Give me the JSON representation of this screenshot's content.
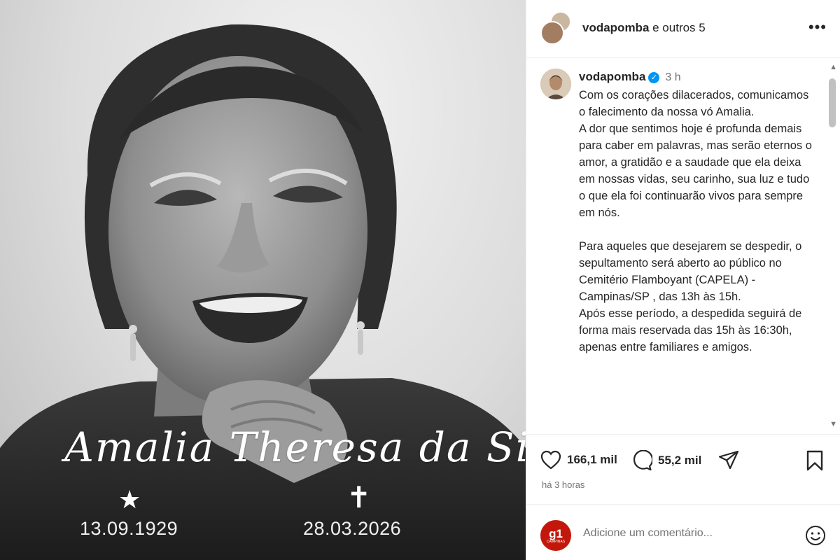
{
  "photo": {
    "name_signature": "Amalia Theresa da Silva",
    "birth_date": "13.09.1929",
    "death_date": "28.03.2026",
    "birth_symbol": "★",
    "death_symbol": "✝"
  },
  "header": {
    "username": "vodapomba",
    "others": " e outros 5",
    "more_icon": "more-horizontal-icon",
    "more_label": "•••"
  },
  "caption": {
    "username": "vodapomba",
    "verified_mark": "✓",
    "time": "3 h",
    "text": "Com os corações dilacerados, comunicamos o falecimento da nossa vó Amalia.\nA dor que sentimos hoje é profunda demais para caber em palavras, mas serão eternos o amor, a gratidão e a saudade que ela deixa em nossas vidas, seu carinho, sua luz e tudo o que ela foi continuarão vivos para sempre em nós.\n\nPara aqueles que desejarem se despedir, o sepultamento será aberto ao público no Cemitério Flamboyant (CAPELA) - Campinas/SP , das 13h às 15h.\nApós esse período, a despedida seguirá de forma mais reservada das 15h às 16:30h, apenas entre familiares e amigos."
  },
  "scrollbar": {
    "up": "▲",
    "down": "▼"
  },
  "actions": {
    "likes": "166,1 mil",
    "comments": "55,2 mil",
    "time_ago": "há 3 horas"
  },
  "comment_bar": {
    "avatar_label": "g1",
    "avatar_sub": "CAMPINAS",
    "placeholder": "Adicione um comentário..."
  },
  "colors": {
    "verified": "#0095f6",
    "g1_red": "#c4170c",
    "text_primary": "#262626",
    "text_secondary": "#737373"
  }
}
